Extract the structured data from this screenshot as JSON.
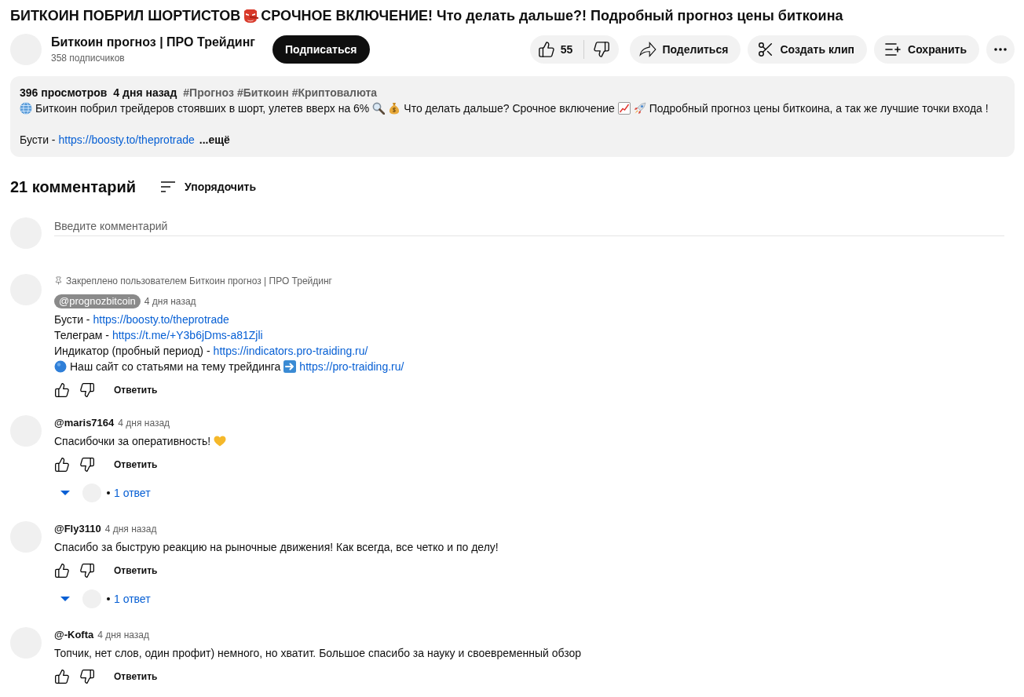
{
  "video": {
    "title": [
      {
        "kind": "text",
        "text": "БИТКОИН ПОБРИЛ ШОРТИСТОВ"
      },
      {
        "kind": "mask"
      },
      {
        "kind": "text",
        "text": "СРОЧНОЕ ВКЛЮЧЕНИЕ! Что делать дальше?! Подробный прогноз цены биткоина"
      }
    ],
    "channel": {
      "name": "Биткоин прогноз | ПРО Трейдинг",
      "subscribers": "358 подписчиков"
    },
    "subscribe_button": "Подписаться",
    "likes": "55",
    "action_buttons": [
      {
        "kind": "share",
        "label": "Поделиться"
      },
      {
        "kind": "clip",
        "label": "Создать клип"
      },
      {
        "kind": "save",
        "label": "Сохранить"
      }
    ],
    "description": {
      "views": "396 просмотров",
      "date": "4 дня назад",
      "hashtags": [
        "#Прогноз",
        "#Биткоин",
        "#Криптовалюта"
      ],
      "paragraphs": [
        [
          {
            "kind": "globe"
          },
          {
            "kind": "text",
            "text": "Биткоин побрил трейдеров стоявших в шорт, улетев вверх на 6%"
          },
          {
            "kind": "magnifier"
          },
          {
            "kind": "moneybag"
          },
          {
            "kind": "text",
            "text": "Что делать дальше? Срочное включение"
          },
          {
            "kind": "chart"
          },
          {
            "kind": "rocket"
          },
          {
            "kind": "text",
            "text": "Подробный прогноз цены биткоина, а так же лучшие точки входа !"
          }
        ],
        [
          {
            "kind": "text",
            "text": "Бусти -"
          },
          {
            "kind": "link",
            "text": "https://boosty.to/theprotrade"
          }
        ]
      ],
      "more": "...ещё"
    }
  },
  "comments": {
    "count": "21 комментарий",
    "sort": "Упорядочить",
    "input": {
      "placeholder": "Введите комментарий"
    },
    "items": [
      {
        "pinned_label": "Закреплено пользователем Биткоин прогноз | ПРО Трейдинг",
        "author": "@prognozbitcoin",
        "is_owner": true,
        "time": "4 дня назад",
        "lines": [
          [
            {
              "kind": "text",
              "text": "Бусти -"
            },
            {
              "kind": "link",
              "text": "https://boosty.to/theprotrade"
            }
          ],
          [
            {
              "kind": "text",
              "text": "Телеграм -"
            },
            {
              "kind": "link",
              "text": "https://t.me/+Y3b6jDms-a81Zjli"
            }
          ],
          [
            {
              "kind": "text",
              "text": "Индикатор (пробный период) -"
            },
            {
              "kind": "link",
              "text": "https://indicators.pro-traiding.ru/"
            }
          ],
          [
            {
              "kind": "dot"
            },
            {
              "kind": "text",
              "text": "Наш сайт со статьями на тему трейдинга"
            },
            {
              "kind": "arrow"
            },
            {
              "kind": "link",
              "text": "https://pro-traiding.ru/"
            }
          ]
        ],
        "reply": "Ответить"
      },
      {
        "author": "@maris7164",
        "is_owner": false,
        "time": "4 дня назад",
        "lines": [
          [
            {
              "kind": "text",
              "text": "Спасибочки за оперативность!"
            },
            {
              "kind": "heart"
            }
          ]
        ],
        "reply": "Ответить",
        "replies": "1 ответ"
      },
      {
        "author": "@Fly3110",
        "is_owner": false,
        "time": "4 дня назад",
        "lines": [
          [
            {
              "kind": "text",
              "text": "Спасибо за быструю реакцию на рыночные движения! Как всегда, все четко и по делу!"
            }
          ]
        ],
        "reply": "Ответить",
        "replies": "1 ответ"
      },
      {
        "author": "@-Kofta",
        "is_owner": false,
        "time": "4 дня назад",
        "lines": [
          [
            {
              "kind": "text",
              "text": "Топчик, нет слов, один профит) немного, но хватит. Большое спасибо за науку и своевременный обзор"
            }
          ]
        ],
        "reply": "Ответить"
      }
    ]
  }
}
